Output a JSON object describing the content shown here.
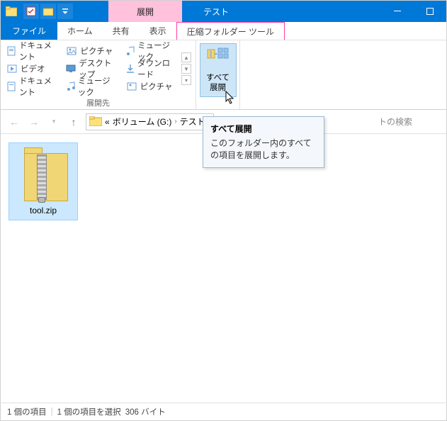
{
  "titlebar": {
    "contextual_tab": "展開",
    "window_title": "テスト"
  },
  "tabs": {
    "file": "ファイル",
    "home": "ホーム",
    "share": "共有",
    "view": "表示",
    "ctx_extract": "圧縮フォルダー ツール"
  },
  "ribbon": {
    "group_dest_label": "展開先",
    "dest": {
      "documents": "ドキュメント",
      "videos": "ビデオ",
      "documents2": "ドキュメント",
      "pictures": "ピクチャ",
      "desktop": "デスクトップ",
      "music": "ミュージック",
      "music2": "ミュージック",
      "downloads": "ダウンロード",
      "pictures2": "ピクチャ"
    },
    "extract_all": {
      "line1": "すべて",
      "line2": "展開"
    }
  },
  "nav": {
    "crumb0": "«",
    "crumb1": "ボリューム (G:)",
    "crumb2": "テスト",
    "search_hint": "トの検索"
  },
  "content": {
    "file_name": "tool.zip"
  },
  "tooltip": {
    "title": "すべて展開",
    "body": "このフォルダー内のすべての項目を展開します。"
  },
  "status": {
    "items": "1 個の項目",
    "selected": "1 個の項目を選択",
    "size": "306 バイト"
  }
}
